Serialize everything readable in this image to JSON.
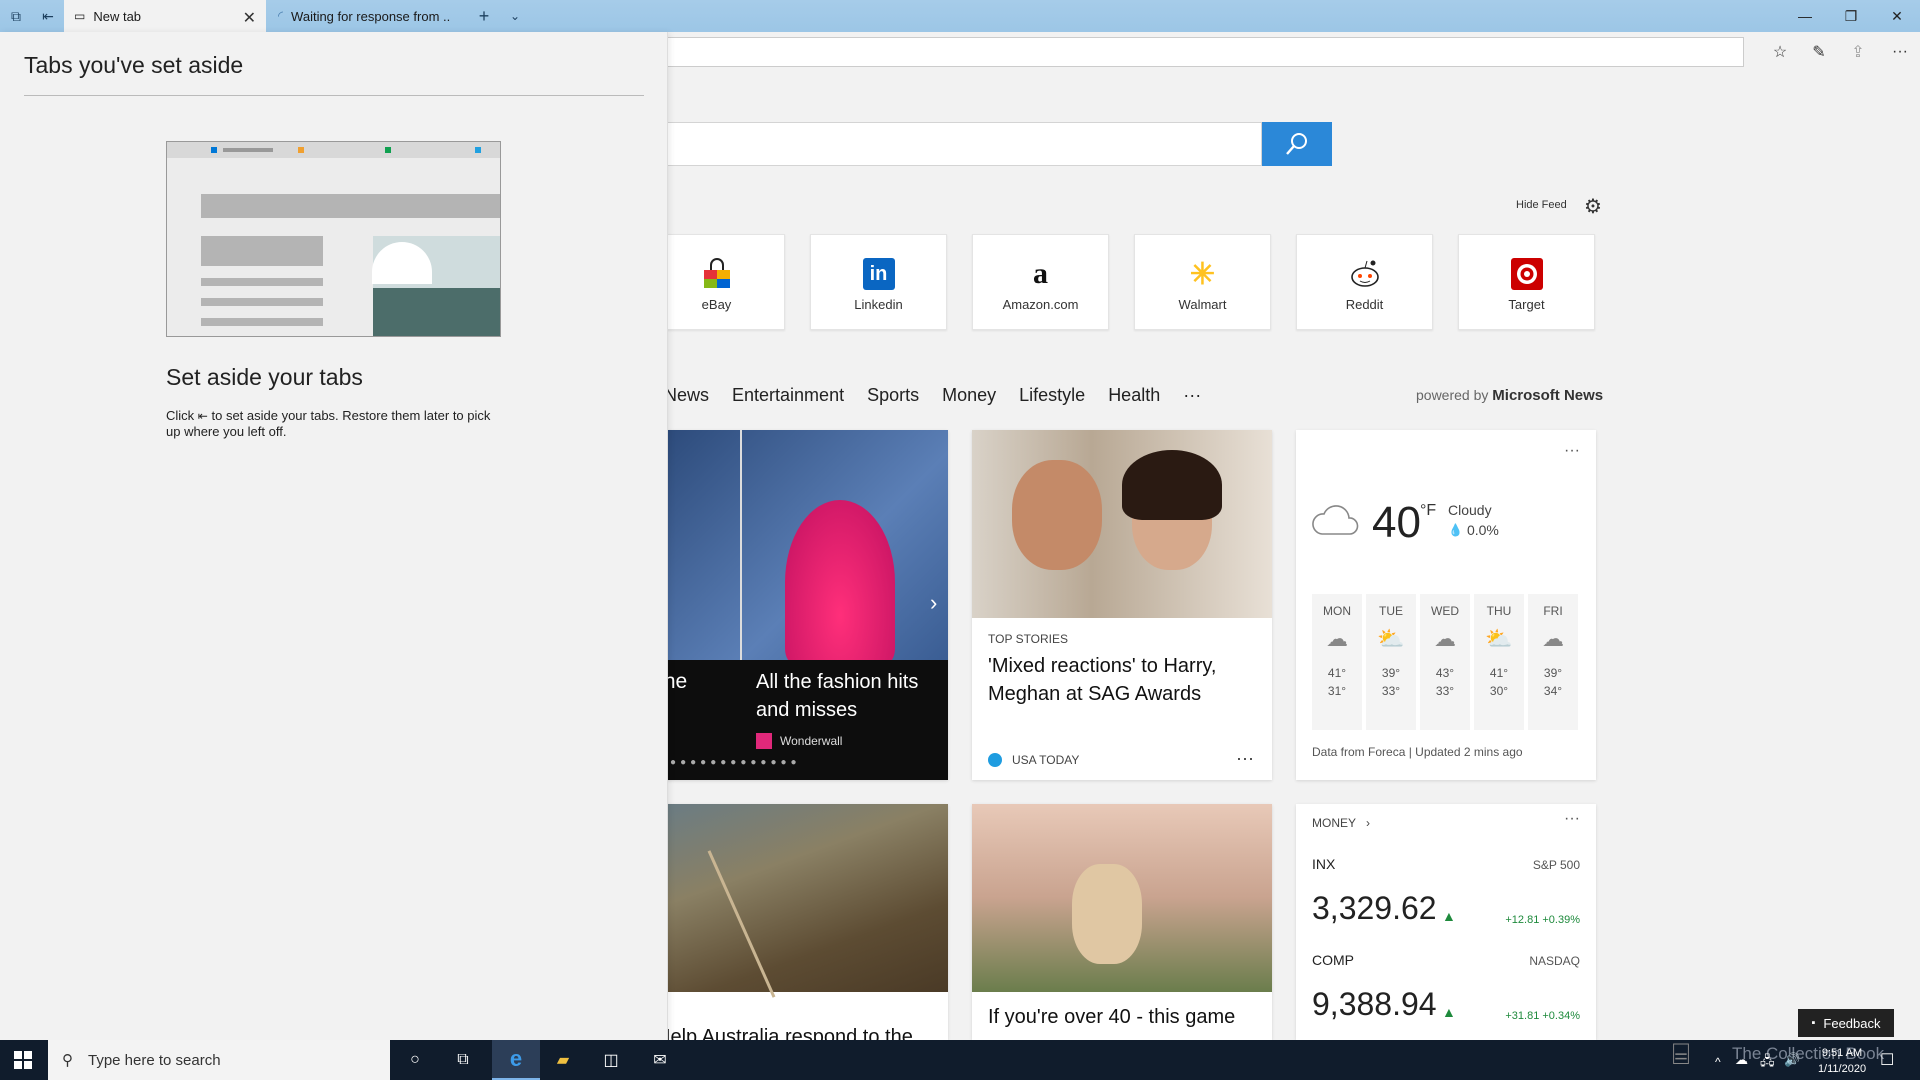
{
  "tabs": [
    {
      "label": "New tab",
      "active": true
    },
    {
      "label": "Waiting for response from ..",
      "active": false
    }
  ],
  "search": {
    "placeholder": ""
  },
  "feed": {
    "hide_label": "Hide Feed"
  },
  "top_sites": [
    "eBay",
    "Linkedin",
    "Amazon.com",
    "Walmart",
    "Reddit",
    "Target"
  ],
  "categories": [
    "News",
    "Entertainment",
    "Sports",
    "Money",
    "Lifestyle",
    "Health",
    "···"
  ],
  "powered": {
    "prefix": "powered by",
    "brand": "Microsoft News"
  },
  "slideshow": {
    "partial_text": "the",
    "title": "All the fashion hits and misses",
    "source": "Wonderwall"
  },
  "top_story": {
    "kicker": "TOP STORIES",
    "title": "'Mixed reactions' to Harry, Meghan at SAG Awards",
    "source": "USA TODAY"
  },
  "weather": {
    "temp": "40",
    "unit": "°F",
    "condition": "Cloudy",
    "precip": "0.0%",
    "days": [
      {
        "day": "MON",
        "hi": "41°",
        "lo": "31°"
      },
      {
        "day": "TUE",
        "hi": "39°",
        "lo": "33°"
      },
      {
        "day": "WED",
        "hi": "43°",
        "lo": "33°"
      },
      {
        "day": "THU",
        "hi": "41°",
        "lo": "30°"
      },
      {
        "day": "FRI",
        "hi": "39°",
        "lo": "34°"
      }
    ],
    "footer": "Data from Foreca | Updated 2 mins ago"
  },
  "money": {
    "label": "MONEY",
    "stocks": [
      {
        "ticker": "INX",
        "name": "S&P 500",
        "value": "3,329.62",
        "change": "+12.81 +0.39%"
      },
      {
        "ticker": "COMP",
        "name": "NASDAQ",
        "value": "9,388.94",
        "change": "+31.81 +0.34%"
      }
    ]
  },
  "bottom_cards": [
    {
      "title": "Help Australia respond to the"
    },
    {
      "title": "If you're over 40 - this game"
    }
  ],
  "panel": {
    "title": "Tabs you've set aside",
    "heading": "Set aside your tabs",
    "text_before": "Click",
    "text_after": "to set aside your tabs. Restore them later to pick up where you left off."
  },
  "taskbar": {
    "search_placeholder": "Type here to search",
    "time": "9:51 AM",
    "date": "1/11/2020"
  },
  "feedback": "Feedback",
  "watermark": "The Collection Book",
  "colors": {
    "accent": "#2b88d8",
    "titlebar": "#9cc6e6",
    "positive": "#1e8a3c",
    "taskbar": "#101c2c"
  }
}
